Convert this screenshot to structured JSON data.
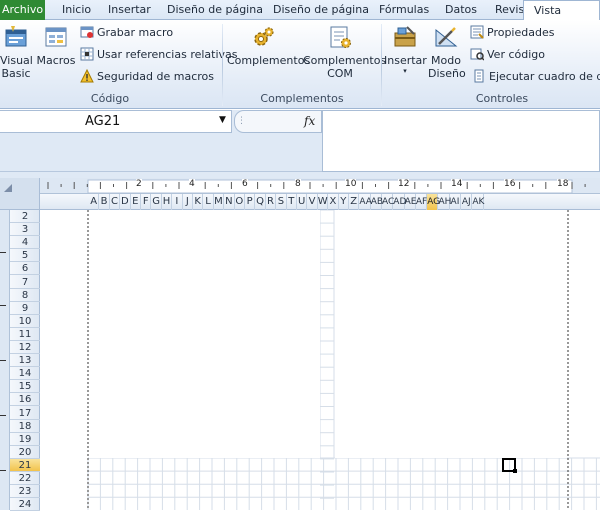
{
  "tabs": [
    {
      "id": "file",
      "label": "Archivo"
    },
    {
      "id": "home",
      "label": "Inicio"
    },
    {
      "id": "insert",
      "label": "Insertar"
    },
    {
      "id": "pagelayout1",
      "label": "Diseño de página"
    },
    {
      "id": "pagelayout2",
      "label": "Diseño de página"
    },
    {
      "id": "formulas",
      "label": "Fórmulas"
    },
    {
      "id": "data",
      "label": "Datos"
    },
    {
      "id": "review",
      "label": "Revisar"
    },
    {
      "id": "view",
      "label": "Vista"
    }
  ],
  "ribbon": {
    "code": {
      "visual_basic": "Visual\nBasic",
      "macros": "Macros",
      "record_macro": "Grabar macro",
      "relative_refs": "Usar referencias relativas",
      "macro_security": "Seguridad de macros",
      "group_label": "Código"
    },
    "addins": {
      "addins": "Complementos",
      "com_addins": "Complementos\nCOM",
      "group_label": "Complementos"
    },
    "controls": {
      "insert": "Insertar",
      "design_mode": "Modo\nDiseño",
      "properties": "Propiedades",
      "view_code": "Ver código",
      "run_dialog": "Ejecutar cuadro de diálo",
      "group_label": "Controles"
    }
  },
  "formula_bar": {
    "name_box": "AG21",
    "fx": "fx",
    "formula": ""
  },
  "ruler": {
    "marks": [
      "2",
      "4",
      "6",
      "8",
      "10",
      "12",
      "14",
      "16",
      "18"
    ]
  },
  "columns": [
    "A",
    "B",
    "C",
    "D",
    "E",
    "F",
    "G",
    "H",
    "I",
    "J",
    "K",
    "L",
    "M",
    "N",
    "O",
    "P",
    "Q",
    "R",
    "S",
    "T",
    "U",
    "V",
    "W",
    "X",
    "Y",
    "Z",
    "AA",
    "AB",
    "AC",
    "AD",
    "AE",
    "AF",
    "AG",
    "AH",
    "AI",
    "AJ",
    "AK"
  ],
  "active_column": "AG",
  "rows": [
    "2",
    "3",
    "4",
    "5",
    "6",
    "7",
    "8",
    "9",
    "10",
    "11",
    "12",
    "13",
    "14",
    "15",
    "16",
    "17",
    "18",
    "19",
    "20",
    "21",
    "22",
    "23",
    "24"
  ],
  "active_row": "21"
}
